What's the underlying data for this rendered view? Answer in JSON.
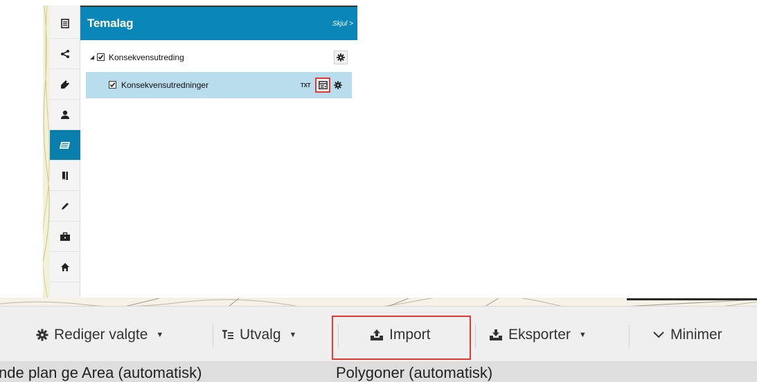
{
  "panel": {
    "title": "Temalag",
    "hide_label": "Skjul >"
  },
  "iconbar": {
    "items": [
      {
        "icon": "document-icon"
      },
      {
        "icon": "share-icon"
      },
      {
        "icon": "tag-icon"
      },
      {
        "icon": "user-icon"
      },
      {
        "icon": "layers-icon",
        "active": true
      },
      {
        "icon": "bookmark-icon"
      },
      {
        "icon": "pencil-icon"
      },
      {
        "icon": "briefcase-icon"
      },
      {
        "icon": "home-icon"
      }
    ]
  },
  "tree": {
    "group": {
      "label": "Konsekvensutreding",
      "checked": true,
      "expanded": true
    },
    "layer": {
      "label": "Konsekvensutredninger",
      "checked": true,
      "txt_label": "TXT"
    }
  },
  "toolbar": {
    "edit_selected": "Rediger valgte",
    "selection": "Utvalg",
    "import": "Import",
    "export": "Eksporter",
    "minimize": "Minimer"
  },
  "columns": {
    "col1": "nde plan ge Area (automatisk)",
    "col2": "Polygoner (automatisk)"
  },
  "colors": {
    "accent": "#0a86b8",
    "active_tab": "#0a7fae",
    "selected_row": "#b9dded",
    "highlight": "#e53935"
  }
}
